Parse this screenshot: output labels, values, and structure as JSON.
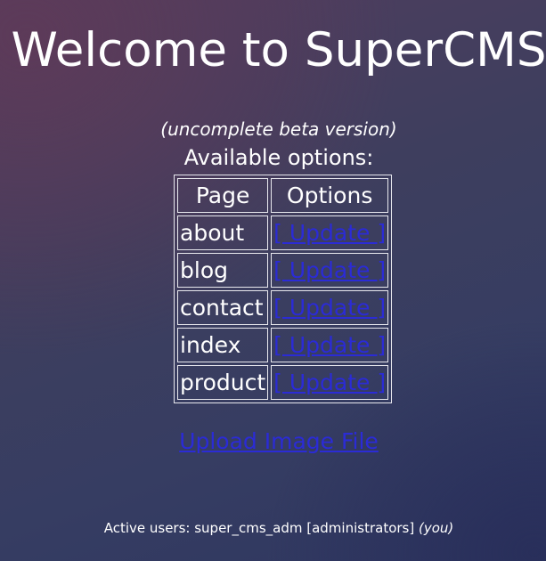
{
  "header": {
    "title": "Welcome to SuperCMS"
  },
  "main": {
    "subtitle": "(uncomplete beta version)",
    "options_label": "Available options:",
    "table": {
      "columns": [
        "Page",
        "Options"
      ],
      "rows": [
        {
          "page": "about",
          "action": "[ Update ]"
        },
        {
          "page": "blog",
          "action": "[ Update ]"
        },
        {
          "page": "contact",
          "action": "[ Update ]"
        },
        {
          "page": "index",
          "action": "[ Update ]"
        },
        {
          "page": "product",
          "action": "[ Update ]"
        }
      ]
    },
    "upload_label": "Upload Image File"
  },
  "footer": {
    "active_users_text": "Active users: super_cms_adm [administrators]",
    "you_label": "(you)"
  },
  "colors": {
    "link": "#2b2bd6",
    "text": "#ffffff",
    "table_border": "#e8e8ee"
  }
}
